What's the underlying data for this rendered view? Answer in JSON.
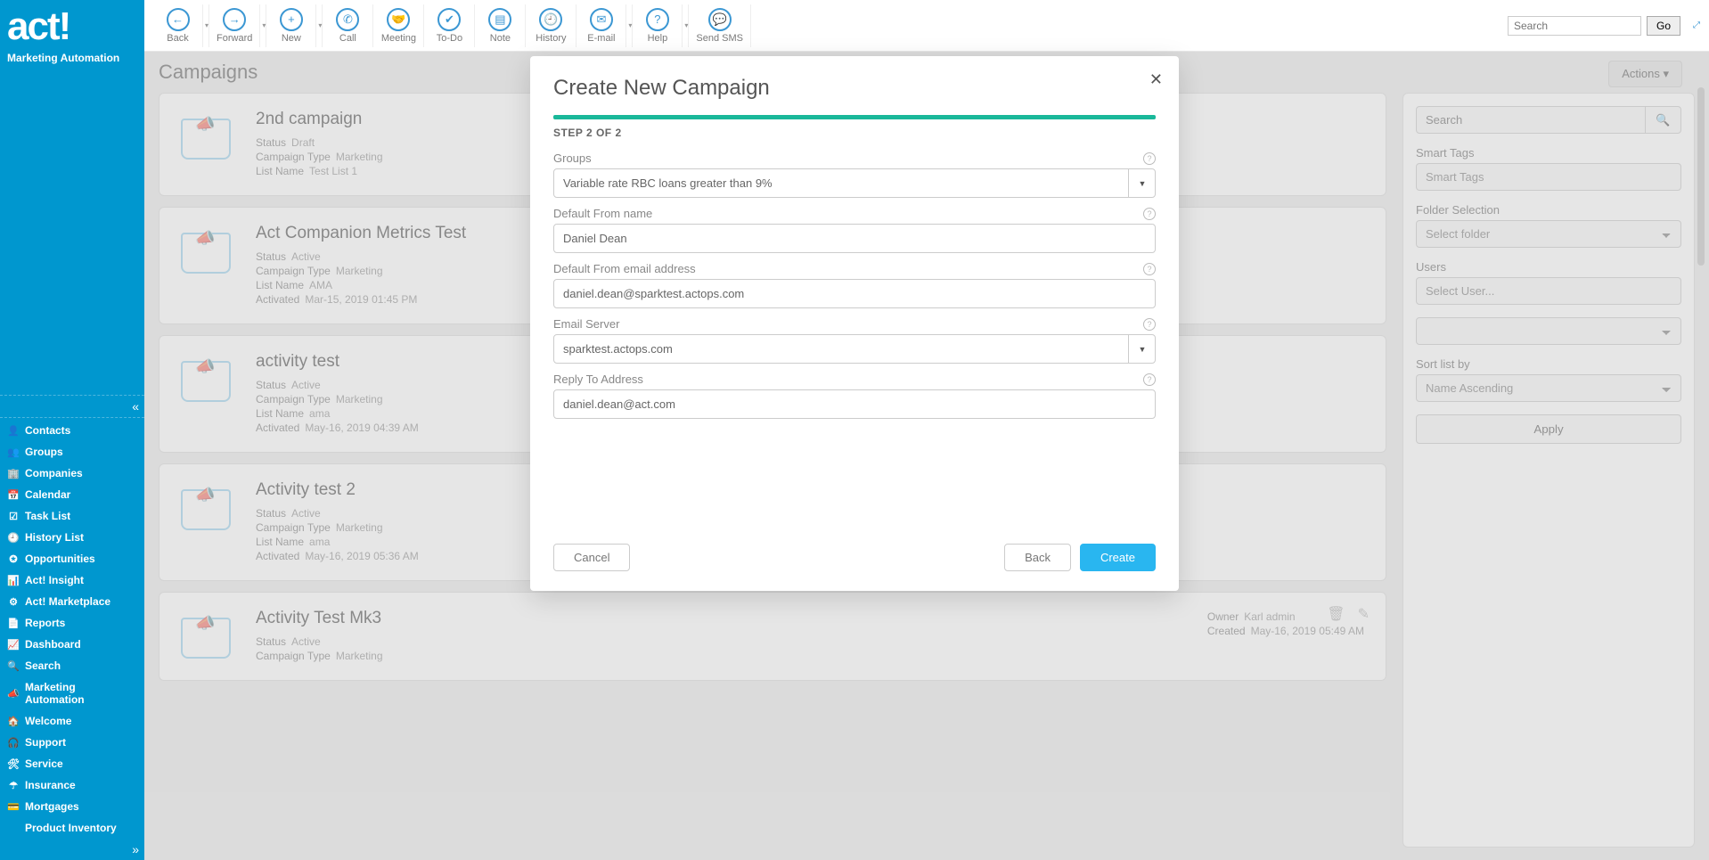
{
  "app": {
    "logo": "act!",
    "subtitle": "Marketing Automation"
  },
  "topbar": {
    "tools": [
      {
        "id": "back",
        "label": "Back",
        "glyph": "←",
        "caret": true
      },
      {
        "id": "forward",
        "label": "Forward",
        "glyph": "→",
        "caret": true
      },
      {
        "id": "new",
        "label": "New",
        "glyph": "+",
        "caret": true
      },
      {
        "id": "call",
        "label": "Call",
        "glyph": "✆",
        "caret": false
      },
      {
        "id": "meeting",
        "label": "Meeting",
        "glyph": "🤝",
        "caret": false
      },
      {
        "id": "todo",
        "label": "To-Do",
        "glyph": "✔",
        "caret": false
      },
      {
        "id": "note",
        "label": "Note",
        "glyph": "▤",
        "caret": false
      },
      {
        "id": "history",
        "label": "History",
        "glyph": "🕘",
        "caret": false
      },
      {
        "id": "email",
        "label": "E-mail",
        "glyph": "✉",
        "caret": true
      },
      {
        "id": "help",
        "label": "Help",
        "glyph": "?",
        "caret": true
      },
      {
        "id": "sendsms",
        "label": "Send SMS",
        "glyph": "💬",
        "caret": false
      }
    ],
    "search_placeholder": "Search",
    "go": "Go"
  },
  "sidebar": {
    "items": [
      {
        "id": "contacts",
        "label": "Contacts",
        "glyph": "👤"
      },
      {
        "id": "groups",
        "label": "Groups",
        "glyph": "👥"
      },
      {
        "id": "companies",
        "label": "Companies",
        "glyph": "🏢"
      },
      {
        "id": "calendar",
        "label": "Calendar",
        "glyph": "📅"
      },
      {
        "id": "tasklist",
        "label": "Task List",
        "glyph": "☑"
      },
      {
        "id": "historylist",
        "label": "History List",
        "glyph": "🕘"
      },
      {
        "id": "opportunities",
        "label": "Opportunities",
        "glyph": "✪"
      },
      {
        "id": "insight",
        "label": "Act! Insight",
        "glyph": "📊"
      },
      {
        "id": "marketplace",
        "label": "Act! Marketplace",
        "glyph": "⚙"
      },
      {
        "id": "reports",
        "label": "Reports",
        "glyph": "📄"
      },
      {
        "id": "dashboard",
        "label": "Dashboard",
        "glyph": "📈"
      },
      {
        "id": "search",
        "label": "Search",
        "glyph": "🔍"
      },
      {
        "id": "marketingautomation",
        "label": "Marketing Automation",
        "glyph": "📣"
      },
      {
        "id": "welcome",
        "label": "Welcome",
        "glyph": "🏠"
      },
      {
        "id": "support",
        "label": "Support",
        "glyph": "🎧"
      },
      {
        "id": "service",
        "label": "Service",
        "glyph": "🛠"
      },
      {
        "id": "insurance",
        "label": "Insurance",
        "glyph": "☂"
      },
      {
        "id": "mortgages",
        "label": "Mortgages",
        "glyph": "💳"
      },
      {
        "id": "productinventory",
        "label": "Product Inventory",
        "glyph": ""
      }
    ]
  },
  "page": {
    "title": "Campaigns",
    "actions": "Actions ▾"
  },
  "campaigns": [
    {
      "title": "2nd campaign",
      "status": "Draft",
      "type": "Marketing",
      "listname": "Test List 1",
      "activated": null
    },
    {
      "title": "Act Companion Metrics Test",
      "status": "Active",
      "type": "Marketing",
      "listname": "AMA",
      "activated": "Mar-15, 2019 01:45 PM"
    },
    {
      "title": "activity test",
      "status": "Active",
      "type": "Marketing",
      "listname": "ama",
      "activated": "May-16, 2019 04:39 AM"
    },
    {
      "title": "Activity test 2",
      "status": "Active",
      "type": "Marketing",
      "listname": "ama",
      "activated": "May-16, 2019 05:36 AM"
    },
    {
      "title": "Activity Test Mk3",
      "status": "Active",
      "type": "Marketing",
      "listname": null,
      "activated": null,
      "owner": "Karl admin",
      "created": "May-16, 2019 05:49 AM"
    }
  ],
  "labels": {
    "status": "Status",
    "type": "Campaign Type",
    "listname": "List Name",
    "activated": "Activated",
    "owner": "Owner",
    "created": "Created"
  },
  "filters": {
    "search_placeholder": "Search",
    "smart_tags_label": "Smart Tags",
    "smart_tags_value": "Smart Tags",
    "folder_label": "Folder Selection",
    "folder_value": "Select folder",
    "users_label": "Users",
    "users_value": "Select User...",
    "sort_label": "Sort list by",
    "sort_value": "Name Ascending",
    "apply": "Apply"
  },
  "modal": {
    "title": "Create New Campaign",
    "step": "STEP 2 OF 2",
    "groups_label": "Groups",
    "groups_value": "Variable rate RBC loans greater than 9%",
    "fromname_label": "Default From name",
    "fromname_value": "Daniel Dean",
    "fromemail_label": "Default From email address",
    "fromemail_value": "daniel.dean@sparktest.actops.com",
    "server_label": "Email Server",
    "server_value": "sparktest.actops.com",
    "reply_label": "Reply To Address",
    "reply_value": "daniel.dean@act.com",
    "cancel": "Cancel",
    "back": "Back",
    "create": "Create"
  }
}
